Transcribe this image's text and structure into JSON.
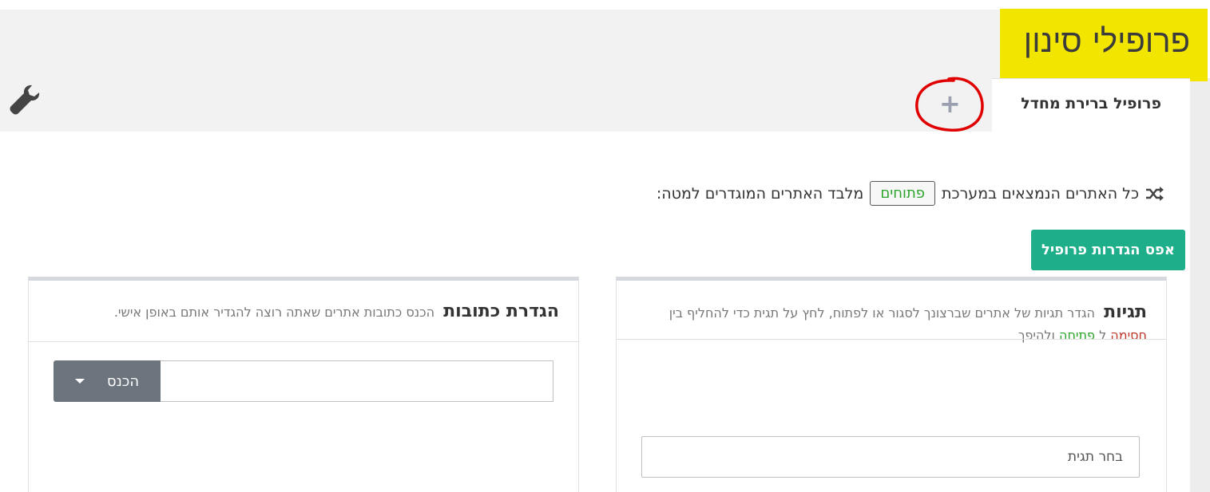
{
  "header": {
    "title": "פרופילי סינון",
    "active_tab": "פרופיל ברירת מחדל",
    "add_tab_icon": "plus-icon",
    "settings_icon": "wrench-icon"
  },
  "statement": {
    "icon": "shuffle-icon",
    "prefix": "כל האתרים הנמצאים במערכת",
    "mode_button": "פתוחים",
    "suffix": "מלבד האתרים המוגדרים למטה:"
  },
  "reset_button": "אפס הגדרות פרופיל",
  "tags_panel": {
    "title": "תגיות",
    "desc_1": "הגדר תגיות של אתרים שברצונך לסגור או לפתוח, לחץ על תגית כדי להחליף בין",
    "word_block": "חסימה",
    "word_to": "ל",
    "word_open": "פתיחה",
    "word_vice": "ולהיפך",
    "select_placeholder": "בחר תגית"
  },
  "address_panel": {
    "title": "הגדרת כתובות",
    "desc": "הכנס כתובות אתרים שאתה רוצה להגדיר אותם באופן אישי.",
    "enter_button": "הכנס"
  },
  "colors": {
    "title_highlight": "#f2e500",
    "reset_button": "#1fae8a",
    "open_green": "#2aa42a",
    "block_red": "#c0392b",
    "annotation_circle": "#e00000"
  }
}
